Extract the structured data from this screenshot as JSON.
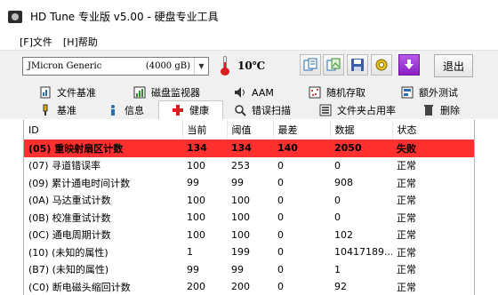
{
  "window": {
    "title": "HD Tune 专业版 v5.00 - 硬盘专业工具"
  },
  "menu": [
    {
      "label": "[F]文件"
    },
    {
      "label": "[H]帮助"
    }
  ],
  "toolbar": {
    "drive_name": "JMicron Generic",
    "drive_size": "(4000 gB)",
    "temperature": "10℃",
    "exit_label": "退出",
    "button_icons": [
      "copy-text-icon",
      "copy-image-icon",
      "save-icon",
      "options-icon",
      "download-icon"
    ]
  },
  "tabs": {
    "row1": [
      {
        "label": "文件基准",
        "icon": "file-benchmark-icon"
      },
      {
        "label": "磁盘监视器",
        "icon": "disk-monitor-icon"
      },
      {
        "label": "AAM",
        "icon": "speaker-icon"
      },
      {
        "label": "随机存取",
        "icon": "random-access-icon"
      },
      {
        "label": "额外测试",
        "icon": "extra-tests-icon"
      }
    ],
    "row2": [
      {
        "label": "基准",
        "icon": "benchmark-icon"
      },
      {
        "label": "信息",
        "icon": "info-icon"
      },
      {
        "label": "健康",
        "icon": "health-icon"
      },
      {
        "label": "错误扫描",
        "icon": "error-scan-icon"
      },
      {
        "label": "文件夹占用率",
        "icon": "folder-usage-icon"
      },
      {
        "label": "删除",
        "icon": "erase-icon"
      }
    ],
    "active": "健康"
  },
  "table": {
    "headers": [
      "ID",
      "当前",
      "阈值",
      "最差",
      "数据",
      "状态"
    ],
    "rows": [
      {
        "id": "(05) 重映射扇区计数",
        "current": "134",
        "threshold": "134",
        "worst": "140",
        "data": "2050",
        "status": "失败",
        "failed": true
      },
      {
        "id": "(07) 寻道错误率",
        "current": "100",
        "threshold": "253",
        "worst": "0",
        "data": "0",
        "status": "正常",
        "failed": false
      },
      {
        "id": "(09) 累计通电时间计数",
        "current": "99",
        "threshold": "99",
        "worst": "0",
        "data": "908",
        "status": "正常",
        "failed": false
      },
      {
        "id": "(0A) 马达重试计数",
        "current": "100",
        "threshold": "100",
        "worst": "0",
        "data": "0",
        "status": "正常",
        "failed": false
      },
      {
        "id": "(0B) 校准重试计数",
        "current": "100",
        "threshold": "100",
        "worst": "0",
        "data": "0",
        "status": "正常",
        "failed": false
      },
      {
        "id": "(0C) 通电周期计数",
        "current": "100",
        "threshold": "100",
        "worst": "0",
        "data": "102",
        "status": "正常",
        "failed": false
      },
      {
        "id": "(10) (未知的属性)",
        "current": "1",
        "threshold": "199",
        "worst": "0",
        "data": "10417189...",
        "status": "正常",
        "failed": false
      },
      {
        "id": "(B7) (未知的属性)",
        "current": "99",
        "threshold": "99",
        "worst": "0",
        "data": "1",
        "status": "正常",
        "failed": false
      },
      {
        "id": "(C0) 断电磁头缩回计数",
        "current": "200",
        "threshold": "200",
        "worst": "0",
        "data": "92",
        "status": "正常",
        "failed": false
      }
    ]
  },
  "colors": {
    "failed_row": "#ff3030",
    "accent_purple": "#9b27d6"
  }
}
